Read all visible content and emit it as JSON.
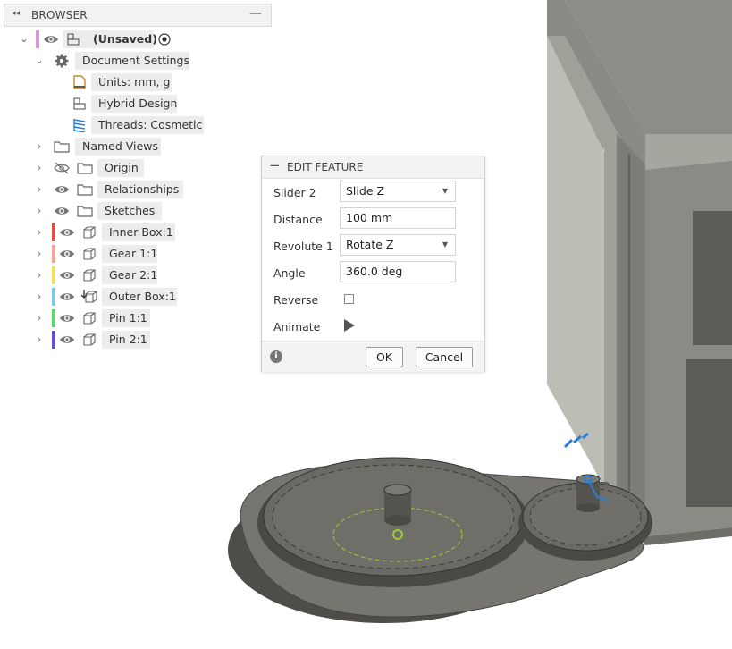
{
  "browser": {
    "title": "BROWSER",
    "collapse_glyph": "◂◂",
    "minimize_glyph": "—",
    "root": {
      "label": "(Unsaved)",
      "color": "#d69ad6"
    },
    "document_settings": {
      "label": "Document Settings",
      "children": [
        {
          "label": "Units: mm, g",
          "icon": "document-icon"
        },
        {
          "label": "Hybrid Design",
          "icon": "hybrid-design-icon"
        },
        {
          "label": "Threads: Cosmetic",
          "icon": "threads-icon"
        }
      ]
    },
    "items": [
      {
        "label": "Named Views",
        "icon": "folder-icon",
        "eye": "none",
        "color": ""
      },
      {
        "label": "Origin",
        "icon": "folder-icon",
        "eye": "hidden",
        "color": ""
      },
      {
        "label": "Relationships",
        "icon": "folder-icon",
        "eye": "visible",
        "color": ""
      },
      {
        "label": "Sketches",
        "icon": "folder-icon",
        "eye": "visible",
        "color": ""
      },
      {
        "label": "Inner Box:1",
        "icon": "component-icon",
        "eye": "visible",
        "color": "#e04e4e"
      },
      {
        "label": "Gear 1:1",
        "icon": "component-icon",
        "eye": "visible",
        "color": "#f4a59a"
      },
      {
        "label": "Gear 2:1",
        "icon": "component-icon",
        "eye": "visible",
        "color": "#f3e061"
      },
      {
        "label": "Outer Box:1",
        "icon": "grounded-component-icon",
        "eye": "visible",
        "color": "#7ec8e3"
      },
      {
        "label": "Pin 1:1",
        "icon": "component-icon",
        "eye": "visible",
        "color": "#66d46d"
      },
      {
        "label": "Pin 2:1",
        "icon": "component-icon",
        "eye": "visible",
        "color": "#6a4fd0"
      }
    ]
  },
  "dialog": {
    "title": "EDIT FEATURE",
    "rows": [
      {
        "label": "Slider 2",
        "value": "Slide Z",
        "type": "select"
      },
      {
        "label": "Distance",
        "value": "100 mm",
        "type": "input"
      },
      {
        "label": "Revolute 1",
        "value": "Rotate Z",
        "type": "select"
      },
      {
        "label": "Angle",
        "value": "360.0 deg",
        "type": "input"
      }
    ],
    "reverse_label": "Reverse",
    "reverse_checked": false,
    "animate_label": "Animate",
    "ok_label": "OK",
    "cancel_label": "Cancel",
    "info_glyph": "i"
  },
  "colors": {
    "accent_blue": "#2a7fd4",
    "sketch_green": "#9acd32"
  }
}
